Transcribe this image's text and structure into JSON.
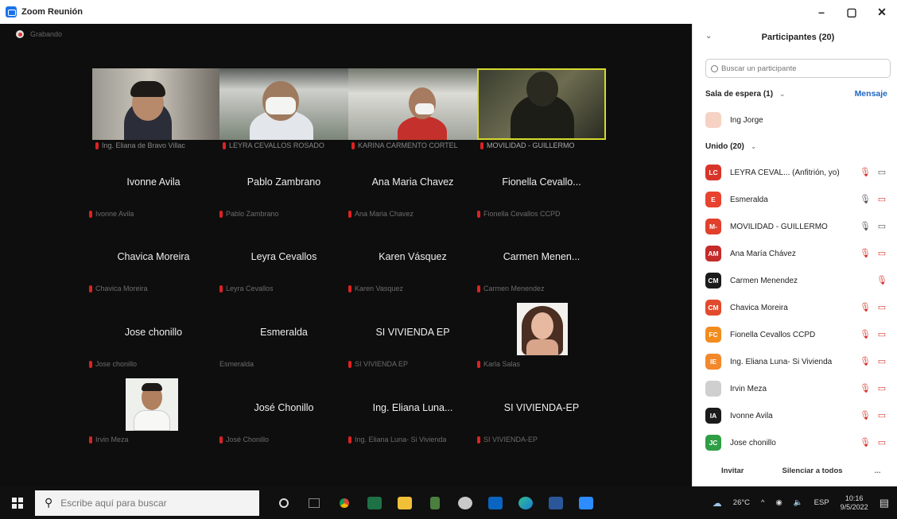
{
  "window": {
    "title": "Zoom Reunión",
    "controls": [
      "–",
      "▢",
      "✕"
    ]
  },
  "recording": {
    "label": "Grabando"
  },
  "video_tiles": [
    {
      "label": "Ing. Eliana de Bravo Villac"
    },
    {
      "label": "LEYRA CEVALLOS ROSADO"
    },
    {
      "label": "KARINA CARMENTO CORTEL"
    },
    {
      "label": "MOVILIDAD - GUILLERMO"
    }
  ],
  "name_tiles": [
    {
      "name": "Ivonne Avila",
      "label": "Ivonne Avila"
    },
    {
      "name": "Pablo Zambrano",
      "label": "Pablo Zambrano"
    },
    {
      "name": "Ana Maria Chavez",
      "label": "Ana Maria Chavez"
    },
    {
      "name": "Fionella  Cevallo...",
      "label": "Fionella Cevallos CCPD"
    },
    {
      "name": "Chavica Moreira",
      "label": "Chavica Moreira"
    },
    {
      "name": "Leyra Cevallos",
      "label": "Leyra Cevallos"
    },
    {
      "name": "Karen Vásquez",
      "label": "Karen Vasquez"
    },
    {
      "name": "Carmen  Menen...",
      "label": "Carmen Menendez"
    },
    {
      "name": "Jose chonillo",
      "label": "Jose chonillo"
    },
    {
      "name": "Esmeralda",
      "label": "Esmeralda"
    },
    {
      "name": "SI VIVIENDA EP",
      "label": "SI VIVIENDA EP"
    },
    {
      "name": "",
      "label": "Karla Salas"
    },
    {
      "name": "",
      "label": "Irvin Meza"
    },
    {
      "name": "José Chonillo",
      "label": "José Chonillo"
    },
    {
      "name": "Ing.  Eliana Luna...",
      "label": "Ing. Eliana Luna- Si Vivienda"
    },
    {
      "name": "SI VIVIENDA-EP",
      "label": "SI VIVIENDA-EP"
    }
  ],
  "panel": {
    "title": "Participantes (20)",
    "search_placeholder": "Buscar un participante",
    "waiting_room": {
      "label": "Sala de espera (1)",
      "message": "Mensaje",
      "person": "Ing Jorge"
    },
    "joined_label": "Unido (20)",
    "participants": [
      {
        "initials": "LC",
        "color": "#d8352a",
        "name": "LEYRA CEVAL... (Anfitrión, yo)"
      },
      {
        "initials": "E",
        "color": "#e8432f",
        "name": "Esmeralda"
      },
      {
        "initials": "M-",
        "color": "#e0402c",
        "name": "MOVILIDAD - GUILLERMO"
      },
      {
        "initials": "AM",
        "color": "#c52b2b",
        "name": "Ana María Chávez"
      },
      {
        "initials": "CM",
        "color": "#1b1b1b",
        "name": "Carmen Menendez"
      },
      {
        "initials": "CM",
        "color": "#e14b2d",
        "name": "Chavica Moreira"
      },
      {
        "initials": "FC",
        "color": "#f28c1e",
        "name": "Fionella Cevallos CCPD"
      },
      {
        "initials": "IE",
        "color": "#f2882a",
        "name": "Ing. Eliana Luna- Si Vivienda"
      },
      {
        "initials": "",
        "color": "#cfcfcf",
        "name": "Irvin Meza"
      },
      {
        "initials": "IA",
        "color": "#1b1b1b",
        "name": "Ivonne Avila"
      },
      {
        "initials": "JC",
        "color": "#2f9e45",
        "name": "Jose chonillo"
      }
    ],
    "footer": {
      "invite": "Invitar",
      "mute_all": "Silenciar a todos",
      "more": "..."
    }
  },
  "taskbar": {
    "search_placeholder": "Escribe aquí para buscar",
    "weather": "26°C",
    "language": "ESP",
    "time": "10:16",
    "date": "9/5/2022"
  }
}
